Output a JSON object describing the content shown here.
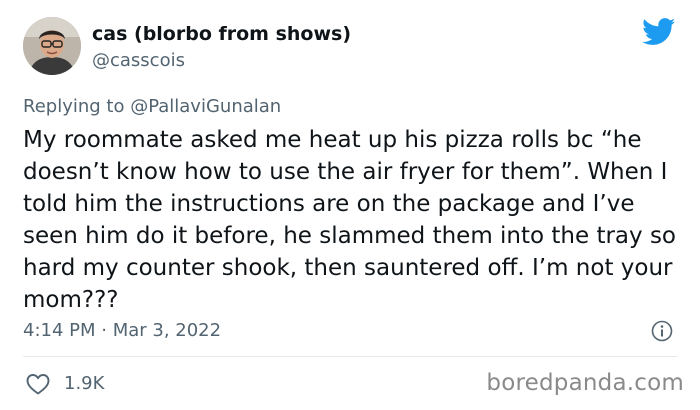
{
  "author": {
    "display_name": "cas (blorbo from shows)",
    "handle": "@casscois",
    "avatar_icon": "profile-photo"
  },
  "platform_icon": "twitter-bird-icon",
  "accent_color": "#1d9bf0",
  "reply": {
    "prefix": "Replying to ",
    "mention": "@PallaviGunalan"
  },
  "tweet": {
    "text": "My roommate asked me heat up his pizza rolls bc “he doesn’t know how to use the air fryer for them”. When I told him the instructions are on the package and I’ve seen him do it before, he slammed them into the tray so hard my counter shook, then sauntered off. I’m not your mom???",
    "timestamp": "4:14 PM · Mar 3, 2022"
  },
  "engagement": {
    "like_icon": "heart-icon",
    "like_count": "1.9K",
    "info_icon": "info-icon"
  },
  "watermark": "boredpanda.com"
}
